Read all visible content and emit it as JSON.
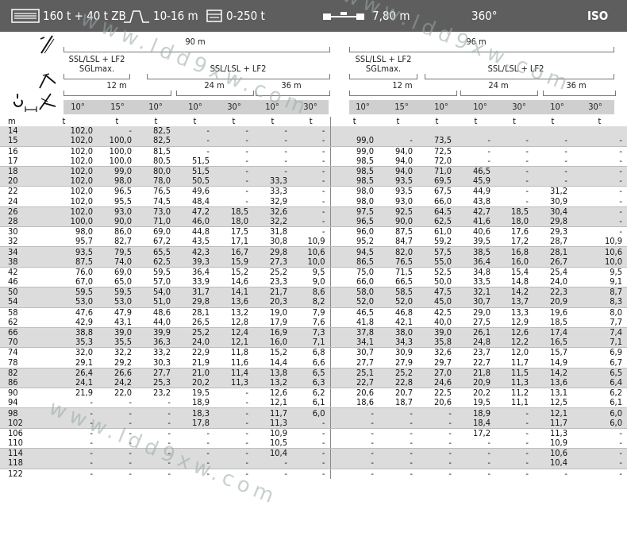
{
  "topbar": {
    "capacity": "160 t + 40 t ZB",
    "outrigger": "10-16 m",
    "counterweight": "0-250 t",
    "spread": "7,80 m",
    "rotation": "360°",
    "standard": "ISO"
  },
  "header": {
    "left_block": {
      "main_boom": "90 m",
      "config_a": "SSL/LSL + LF2",
      "config_a_sub": "SGLmax.",
      "config_b": "SSL/LSL + LF2",
      "jib_a": "12 m",
      "jib_b": "24 m",
      "jib_c": "36 m",
      "angles": [
        "10°",
        "15°",
        "10°",
        "10°",
        "30°",
        "10°",
        "30°"
      ]
    },
    "right_block": {
      "main_boom": "96 m",
      "config_a": "SSL/LSL + LF2",
      "config_a_sub": "SGLmax.",
      "config_b": "SSL/LSL + LF2",
      "jib_a": "12 m",
      "jib_b": "24 m",
      "jib_c": "36 m",
      "angles": [
        "10°",
        "15°",
        "10°",
        "10°",
        "30°",
        "10°",
        "30°"
      ]
    },
    "units": [
      "m",
      "t",
      "t",
      "t",
      "t",
      "t",
      "t",
      "t",
      "t",
      "t",
      "t",
      "t",
      "t",
      "t",
      "t"
    ]
  },
  "rows": [
    [
      "14",
      "102,0",
      "-",
      "82,5",
      "-",
      "-",
      "-",
      "-",
      "",
      "",
      "",
      "",
      "",
      "",
      ""
    ],
    [
      "15",
      "102,0",
      "100,0",
      "82,5",
      "-",
      "-",
      "-",
      "-",
      "99,0",
      "-",
      "73,5",
      "-",
      "-",
      "-",
      "-"
    ],
    [
      "16",
      "102,0",
      "100,0",
      "81,5",
      "-",
      "-",
      "-",
      "-",
      "99,0",
      "94,0",
      "72,5",
      "-",
      "-",
      "-",
      "-"
    ],
    [
      "17",
      "102,0",
      "100,0",
      "80,5",
      "51,5",
      "-",
      "-",
      "-",
      "98,5",
      "94,0",
      "72,0",
      "-",
      "-",
      "-",
      "-"
    ],
    [
      "18",
      "102,0",
      "99,0",
      "80,0",
      "51,5",
      "-",
      "-",
      "-",
      "98,5",
      "94,0",
      "71,0",
      "46,5",
      "-",
      "-",
      "-"
    ],
    [
      "20",
      "102,0",
      "98,0",
      "78,0",
      "50,5",
      "-",
      "33,3",
      "-",
      "98,5",
      "93,5",
      "69,5",
      "45,9",
      "-",
      "-",
      "-"
    ],
    [
      "22",
      "102,0",
      "96,5",
      "76,5",
      "49,6",
      "-",
      "33,3",
      "-",
      "98,0",
      "93,5",
      "67,5",
      "44,9",
      "-",
      "31,2",
      "-"
    ],
    [
      "24",
      "102,0",
      "95,5",
      "74,5",
      "48,4",
      "-",
      "32,9",
      "-",
      "98,0",
      "93,0",
      "66,0",
      "43,8",
      "-",
      "30,9",
      "-"
    ],
    [
      "26",
      "102,0",
      "93,0",
      "73,0",
      "47,2",
      "18,5",
      "32,6",
      "-",
      "97,5",
      "92,5",
      "64,5",
      "42,7",
      "18,5",
      "30,4",
      "-"
    ],
    [
      "28",
      "100,0",
      "90,0",
      "71,0",
      "46,0",
      "18,0",
      "32,2",
      "-",
      "96,5",
      "90,0",
      "62,5",
      "41,6",
      "18,0",
      "29,8",
      "-"
    ],
    [
      "30",
      "98,0",
      "86,0",
      "69,0",
      "44,8",
      "17,5",
      "31,8",
      "-",
      "96,0",
      "87,5",
      "61,0",
      "40,6",
      "17,6",
      "29,3",
      "-"
    ],
    [
      "32",
      "95,7",
      "82,7",
      "67,2",
      "43,5",
      "17,1",
      "30,8",
      "10,9",
      "95,2",
      "84,7",
      "59,2",
      "39,5",
      "17,2",
      "28,7",
      "10,9"
    ],
    [
      "34",
      "93,5",
      "79,5",
      "65,5",
      "42,3",
      "16,7",
      "29,8",
      "10,6",
      "94,5",
      "82,0",
      "57,5",
      "38,5",
      "16,8",
      "28,1",
      "10,6"
    ],
    [
      "38",
      "87,5",
      "74,0",
      "62,5",
      "39,3",
      "15,9",
      "27,3",
      "10,0",
      "86,5",
      "76,5",
      "55,0",
      "36,4",
      "16,0",
      "26,7",
      "10,0"
    ],
    [
      "42",
      "76,0",
      "69,0",
      "59,5",
      "36,4",
      "15,2",
      "25,2",
      "9,5",
      "75,0",
      "71,5",
      "52,5",
      "34,8",
      "15,4",
      "25,4",
      "9,5"
    ],
    [
      "46",
      "67,0",
      "65,0",
      "57,0",
      "33,9",
      "14,6",
      "23,3",
      "9,0",
      "66,0",
      "66,5",
      "50,0",
      "33,5",
      "14,8",
      "24,0",
      "9,1"
    ],
    [
      "50",
      "59,5",
      "59,5",
      "54,0",
      "31,7",
      "14,1",
      "21,7",
      "8,6",
      "58,0",
      "58,5",
      "47,5",
      "32,1",
      "14,2",
      "22,3",
      "8,7"
    ],
    [
      "54",
      "53,0",
      "53,0",
      "51,0",
      "29,8",
      "13,6",
      "20,3",
      "8,2",
      "52,0",
      "52,0",
      "45,0",
      "30,7",
      "13,7",
      "20,9",
      "8,3"
    ],
    [
      "58",
      "47,6",
      "47,9",
      "48,6",
      "28,1",
      "13,2",
      "19,0",
      "7,9",
      "46,5",
      "46,8",
      "42,5",
      "29,0",
      "13,3",
      "19,6",
      "8,0"
    ],
    [
      "62",
      "42,9",
      "43,1",
      "44,0",
      "26,5",
      "12,8",
      "17,9",
      "7,6",
      "41,8",
      "42,1",
      "40,0",
      "27,5",
      "12,9",
      "18,5",
      "7,7"
    ],
    [
      "66",
      "38,8",
      "39,0",
      "39,9",
      "25,2",
      "12,4",
      "16,9",
      "7,3",
      "37,8",
      "38,0",
      "39,0",
      "26,1",
      "12,6",
      "17,4",
      "7,4"
    ],
    [
      "70",
      "35,3",
      "35,5",
      "36,3",
      "24,0",
      "12,1",
      "16,0",
      "7,1",
      "34,1",
      "34,3",
      "35,8",
      "24,8",
      "12,2",
      "16,5",
      "7,1"
    ],
    [
      "74",
      "32,0",
      "32,2",
      "33,2",
      "22,9",
      "11,8",
      "15,2",
      "6,8",
      "30,7",
      "30,9",
      "32,6",
      "23,7",
      "12,0",
      "15,7",
      "6,9"
    ],
    [
      "78",
      "29,1",
      "29,2",
      "30,3",
      "21,9",
      "11,6",
      "14,4",
      "6,6",
      "27,7",
      "27,9",
      "29,7",
      "22,7",
      "11,7",
      "14,9",
      "6,7"
    ],
    [
      "82",
      "26,4",
      "26,6",
      "27,7",
      "21,0",
      "11,4",
      "13,8",
      "6,5",
      "25,1",
      "25,2",
      "27,0",
      "21,8",
      "11,5",
      "14,2",
      "6,5"
    ],
    [
      "86",
      "24,1",
      "24,2",
      "25,3",
      "20,2",
      "11,3",
      "13,2",
      "6,3",
      "22,7",
      "22,8",
      "24,6",
      "20,9",
      "11,3",
      "13,6",
      "6,4"
    ],
    [
      "90",
      "21,9",
      "22,0",
      "23,2",
      "19,5",
      "-",
      "12,6",
      "6,2",
      "20,6",
      "20,7",
      "22,5",
      "20,2",
      "11,2",
      "13,1",
      "6,2"
    ],
    [
      "94",
      "-",
      "-",
      "-",
      "18,9",
      "-",
      "12,1",
      "6,1",
      "18,6",
      "18,7",
      "20,6",
      "19,5",
      "11,1",
      "12,5",
      "6,1"
    ],
    [
      "98",
      "-",
      "-",
      "-",
      "18,3",
      "-",
      "11,7",
      "6,0",
      "-",
      "-",
      "-",
      "18,9",
      "-",
      "12,1",
      "6,0"
    ],
    [
      "102",
      "-",
      "-",
      "-",
      "17,8",
      "-",
      "11,3",
      "-",
      "-",
      "-",
      "-",
      "18,4",
      "-",
      "11,7",
      "6,0"
    ],
    [
      "106",
      "-",
      "-",
      "-",
      "-",
      "-",
      "10,9",
      "-",
      "-",
      "-",
      "-",
      "17,2",
      "-",
      "11,3",
      "-"
    ],
    [
      "110",
      "-",
      "-",
      "-",
      "-",
      "-",
      "10,5",
      "-",
      "-",
      "-",
      "-",
      "-",
      "-",
      "10,9",
      "-"
    ],
    [
      "114",
      "-",
      "-",
      "-",
      "-",
      "-",
      "10,4",
      "-",
      "-",
      "-",
      "-",
      "-",
      "-",
      "10,6",
      "-"
    ],
    [
      "118",
      "-",
      "-",
      "-",
      "-",
      "-",
      "-",
      "-",
      "-",
      "-",
      "-",
      "-",
      "-",
      "10,4",
      "-"
    ],
    [
      "122",
      "-",
      "-",
      "-",
      "-",
      "-",
      "-",
      "-",
      "-",
      "-",
      "-",
      "-",
      "-",
      "-",
      "-"
    ]
  ],
  "watermark": "www.ldd9xw.com",
  "colors": {
    "topbar": "#5e5e5e",
    "shade": "#dcdcdc",
    "header_bar": "#cfcfcf"
  }
}
